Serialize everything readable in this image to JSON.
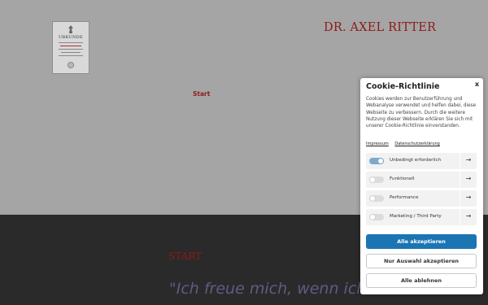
{
  "header": {
    "site_title": "DR. AXEL RITTER",
    "certificate_heading": "URKUNDE"
  },
  "nav": {
    "start_label": "Start"
  },
  "content": {
    "section_heading": "START",
    "quote": "\"Ich freue mich, wenn ich e"
  },
  "cookie_banner": {
    "title": "Cookie-Richtlinie",
    "close_label": "x",
    "text": "Cookies werden zur Benutzerführung und Webanalyse verwendet und helfen dabei, diese Webseite zu verbessern. Durch die weitere Nutzung dieser Webseite erklären Sie sich mit unserer Cookie-Richtlinie einverstanden.",
    "links": [
      "Impressum",
      "Datenschutzerklärung"
    ],
    "categories": [
      {
        "label": "Unbedingt erforderlich",
        "enabled": true,
        "arrow": "→"
      },
      {
        "label": "Funktionell",
        "enabled": false,
        "arrow": "→"
      },
      {
        "label": "Performance",
        "enabled": false,
        "arrow": "→"
      },
      {
        "label": "Marketing / Third Party",
        "enabled": false,
        "arrow": "→"
      }
    ],
    "buttons": {
      "accept_all": "Alle akzeptieren",
      "accept_selection": "Nur Auswahl akzeptieren",
      "reject_all": "Alle ablehnen"
    }
  },
  "colors": {
    "brand_red": "#8e1a1a",
    "accept_blue": "#1b75b3",
    "toggle_on": "#7fa9cf",
    "quote_color": "#5e5c84"
  }
}
